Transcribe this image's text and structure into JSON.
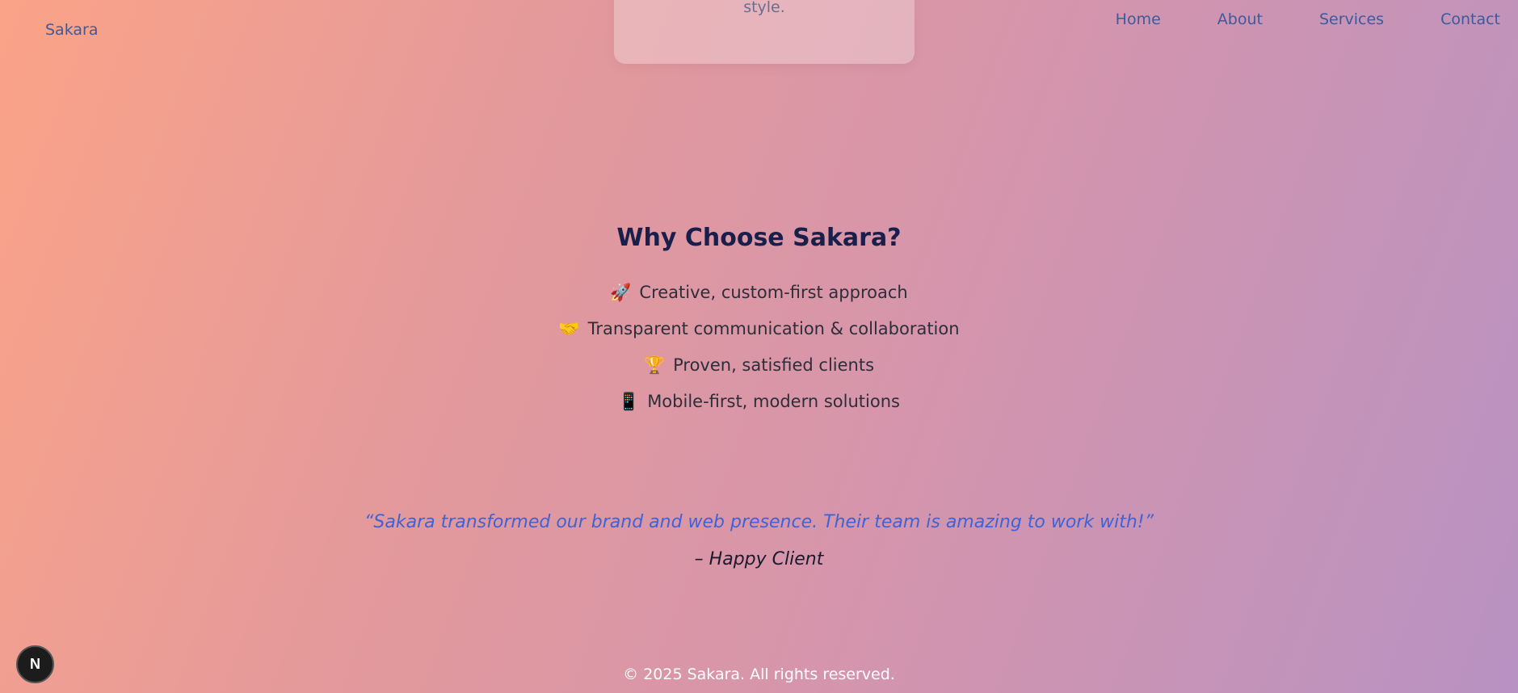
{
  "header": {
    "brand": "Sakara",
    "nav": [
      "Home",
      "About",
      "Services",
      "Contact"
    ]
  },
  "card_partial": {
    "text": "style."
  },
  "why": {
    "title": "Why Choose Sakara?",
    "items": [
      {
        "icon": "🚀",
        "icon_name": "rocket-icon",
        "text": "Creative, custom-first approach"
      },
      {
        "icon": "🤝",
        "icon_name": "handshake-icon",
        "text": "Transparent communication & collaboration"
      },
      {
        "icon": "🏆",
        "icon_name": "trophy-icon",
        "text": "Proven, satisfied clients"
      },
      {
        "icon": "📱",
        "icon_name": "mobile-phone-icon",
        "text": "Mobile-first, modern solutions"
      }
    ]
  },
  "testimonial": {
    "quote": "“Sakara transformed our brand and web presence. Their team is amazing to work with!”",
    "author": "– Happy Client"
  },
  "footer": {
    "copyright": "© 2025 Sakara. All rights reserved."
  },
  "dev_badge": {
    "label": "N"
  },
  "colors": {
    "nav_link": "#3f5a9c",
    "heading": "#1a1e4a",
    "quote": "#3f63d6",
    "gradient_start": "#fba388",
    "gradient_end": "#b892c2"
  }
}
